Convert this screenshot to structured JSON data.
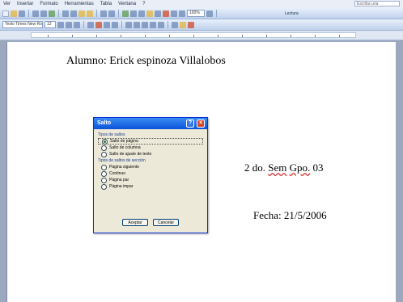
{
  "menubar": {
    "items": [
      "Ver",
      "Insertar",
      "Formato",
      "Herramientas",
      "Tabla",
      "Ventana",
      "?"
    ],
    "help_placeholder": "Escriba una"
  },
  "toolbar": {
    "style_value": "Texto Times New Roman",
    "font_size_value": "12",
    "zoom_value": "100%",
    "read_label": "Lectura"
  },
  "document": {
    "student_line": "Alumno: Erick espinoza Villalobos",
    "grade_prefix": "2 do.",
    "grade_sem": "Sem",
    "grade_gpo": "Gpo.",
    "grade_number": "03",
    "date_line": "Fecha: 21/5/2006"
  },
  "dialog": {
    "title": "Salto",
    "help_glyph": "?",
    "close_glyph": "×",
    "group1_label": "Tipos de saltos",
    "group1_options": [
      "Salto de página",
      "Salto de columna",
      "Salto de ajuste de texto"
    ],
    "group2_label": "Tipos de saltos de sección",
    "group2_options": [
      "Página siguiente",
      "Continuo",
      "Página par",
      "Página impar"
    ],
    "accept_label": "Aceptar",
    "cancel_label": "Cancelar",
    "selected_option": "Salto de página"
  }
}
